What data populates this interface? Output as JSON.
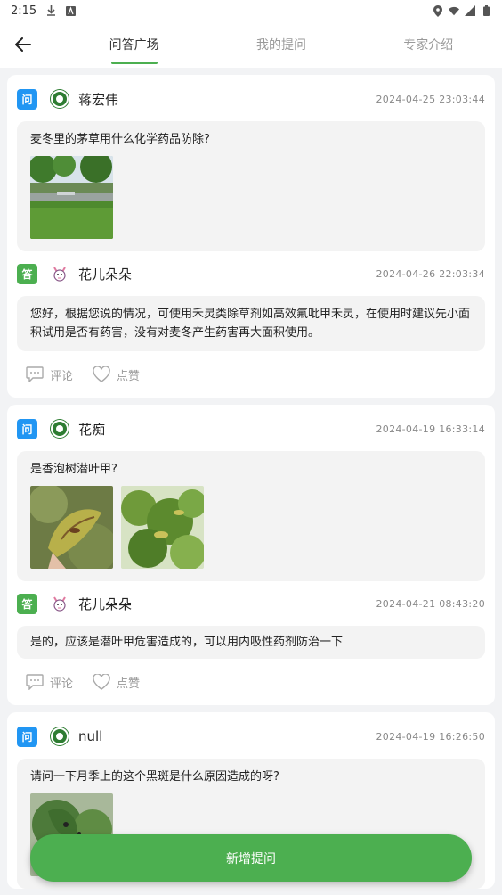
{
  "status_bar": {
    "time": "2:15"
  },
  "header": {
    "tabs": [
      {
        "label": "问答广场"
      },
      {
        "label": "我的提问"
      },
      {
        "label": "专家介绍"
      }
    ]
  },
  "badges": {
    "question": "问",
    "answer": "答"
  },
  "actions": {
    "comment": "评论",
    "like": "点赞"
  },
  "posts": [
    {
      "asker": "蒋宏伟",
      "ask_time": "2024-04-25 23:03:44",
      "question": "麦冬里的茅草用什么化学药品防除?",
      "answerer": "花儿朵朵",
      "answer_time": "2024-04-26 22:03:34",
      "answer": "您好，根据您说的情况，可使用禾灵类除草剂如高效氟吡甲禾灵，在使用时建议先小面积试用是否有药害，没有对麦冬产生药害再大面积使用。"
    },
    {
      "asker": "花痴",
      "ask_time": "2024-04-19 16:33:14",
      "question": "是香泡树潜叶甲?",
      "answerer": "花儿朵朵",
      "answer_time": "2024-04-21 08:43:20",
      "answer": "是的，应该是潜叶甲危害造成的，可以用内吸性药剂防治一下"
    },
    {
      "asker": "null",
      "ask_time": "2024-04-19 16:26:50",
      "question": "请问一下月季上的这个黑斑是什么原因造成的呀?"
    }
  ],
  "fab": {
    "label": "新增提问"
  },
  "colors": {
    "accent": "#4caf50",
    "question_badge": "#2196f3",
    "answer_badge": "#4caf50"
  }
}
